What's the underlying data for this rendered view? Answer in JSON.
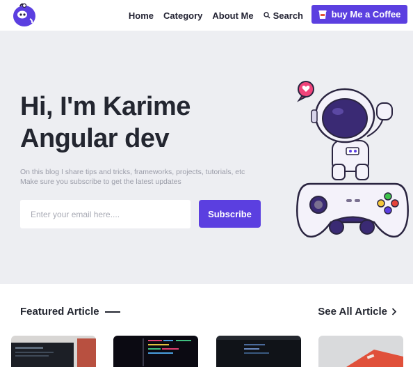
{
  "nav": {
    "links": [
      "Home",
      "Category",
      "About Me"
    ],
    "search_label": "Search",
    "coffee_label": "buy Me a Coffee"
  },
  "hero": {
    "title_line1": "Hi, I'm Karime",
    "title_line2": "Angular dev",
    "desc_line1": "On this blog I share tips and tricks, frameworks, projects, tutorials, etc",
    "desc_line2": "Make sure you subscribe to get the latest updates",
    "email_placeholder": "Enter your email here....",
    "subscribe_label": "Subscribe"
  },
  "featured": {
    "title": "Featured Article",
    "see_all": "See All Article"
  },
  "colors": {
    "accent": "#5b3fe0",
    "hero_bg": "#edeef2"
  },
  "icons": {
    "logo": "ghost-logo-icon",
    "search": "search-icon",
    "coffee": "coffee-cup-icon",
    "see_all": "chevron-right-icon",
    "hero_illustration": "astronaut-gamepad-illustration"
  }
}
